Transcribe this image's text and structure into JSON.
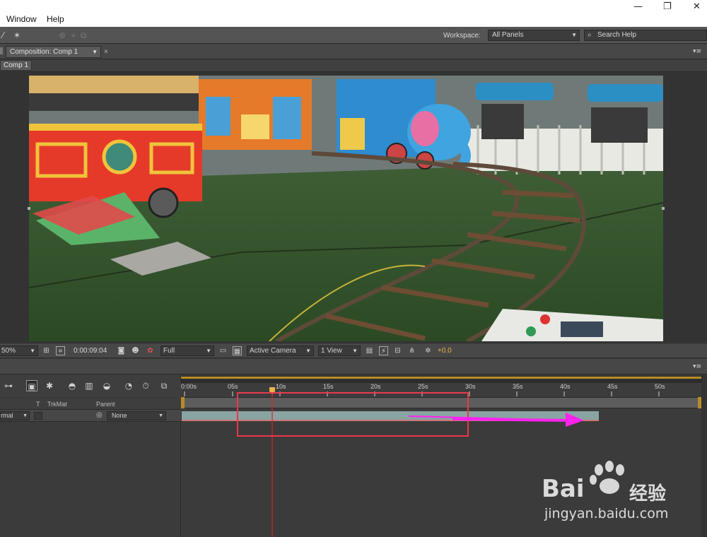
{
  "menu": {
    "items": [
      "Window",
      "Help"
    ]
  },
  "window_controls": {
    "minimize": "—",
    "restore": "❐",
    "close": "✕"
  },
  "toolbar": {
    "workspace_label": "Workspace:",
    "workspace_value": "All Panels",
    "search_placeholder": "Search Help"
  },
  "comp_panel": {
    "tab_label": "Composition: Comp 1",
    "breadcrumb": "Comp 1"
  },
  "viewer_controls": {
    "zoom": "50%",
    "timecode": "0:00:09:04",
    "resolution": "Full",
    "view": "Active Camera",
    "layout": "1 View",
    "exposure": "+0.0"
  },
  "timeline": {
    "columns": {
      "t": "T",
      "trkmat": "TrkMat",
      "parent": "Parent"
    },
    "layer": {
      "mode": "rmal",
      "parent": "None"
    },
    "ticks": [
      "0:00s",
      "05s",
      "10s",
      "15s",
      "20s",
      "25s",
      "30s",
      "35s",
      "40s",
      "45s",
      "50s"
    ]
  },
  "watermark": {
    "brand": "Bai",
    "brand_cn": "经验",
    "url": "jingyan.baidu.com"
  },
  "colors": {
    "panel_bg": "#3b3b3b",
    "highlight_box": "#e8394a",
    "arrow": "#ff22ee",
    "playhead": "#e02020",
    "work_area_end": "#b88c2a"
  }
}
